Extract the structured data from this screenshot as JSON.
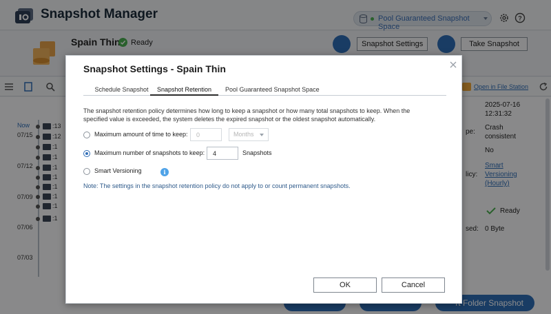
{
  "app": {
    "title": "Snapshot Manager",
    "pool_selector": "Pool Guaranteed Snapshot Space"
  },
  "volume": {
    "name": "Spain Thin",
    "status": "Ready"
  },
  "header_buttons": {
    "snapshot_settings": "Snapshot Settings",
    "take_snapshot": "Take Snapshot"
  },
  "toolbar": {
    "open_in_file_station": "Open in File Station"
  },
  "timeline": {
    "labels": [
      "Now",
      "07/15",
      "07/12",
      "07/09",
      "07/06",
      "07/03"
    ],
    "rows": [
      ":13",
      ":12",
      ":1",
      ":1",
      ":1",
      ":1",
      ":1",
      ":1",
      ":1",
      ":1"
    ]
  },
  "details": {
    "date": "2025-07-16",
    "time": "12:31:32",
    "type_key_fragment": "pe:",
    "type_value_line1": "Crash",
    "type_value_line2": "consistent",
    "locked_value": "No",
    "policy_key_fragment": "licy:",
    "policy_link_line1": "Smart",
    "policy_link_line2": "Versioning",
    "policy_link_line3": "(Hourly)",
    "status_value": "Ready",
    "used_key_fragment": "sed:",
    "used_value": "0 Byte"
  },
  "bottom_buttons": {
    "revert_folder_snapshot": "rt Folder Snapshot"
  },
  "modal": {
    "title": "Snapshot Settings - Spain Thin",
    "tabs": [
      {
        "label": "Schedule Snapshot",
        "active": false
      },
      {
        "label": "Snapshot Retention",
        "active": true
      },
      {
        "label": "Pool Guaranteed Snapshot Space",
        "active": false
      }
    ],
    "description": "The snapshot retention policy determines how long to keep a snapshot or how many total snapshots to keep. When the specified value is exceeded, the system deletes the expired snapshot or the oldest snapshot automatically.",
    "options": {
      "max_time_label": "Maximum amount of time to keep:",
      "max_time_value": "0",
      "max_time_unit": "Months",
      "max_count_label": "Maximum number of snapshots to keep:",
      "max_count_value": "4",
      "max_count_unit": "Snapshots",
      "smart_versioning_label": "Smart Versioning",
      "selected": "max_count"
    },
    "note": "Note: The settings in the snapshot retention policy do not apply to or count permanent snapshots.",
    "ok_label": "OK",
    "cancel_label": "Cancel"
  },
  "colors": {
    "accent": "#2f6db6",
    "success": "#4caf50",
    "info": "#4fa3e8"
  }
}
